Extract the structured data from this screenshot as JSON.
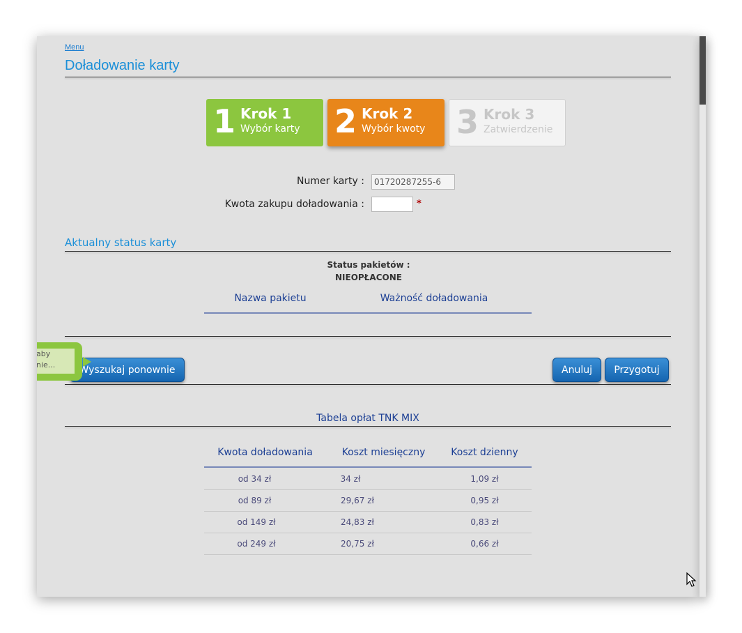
{
  "nav": {
    "menu_link": "Menu"
  },
  "page_title": "Doładowanie karty",
  "steps": [
    {
      "number": "1",
      "title": "Krok 1",
      "subtitle": "Wybór karty",
      "color": "#8cc63f"
    },
    {
      "number": "2",
      "title": "Krok 2",
      "subtitle": "Wybór kwoty",
      "color": "#e8861a"
    },
    {
      "number": "3",
      "title": "Krok 3",
      "subtitle": "Zatwierdzenie",
      "color": "#f3f3f3"
    }
  ],
  "form": {
    "card_number_label": "Numer karty :",
    "card_number_value": "01720287255-6",
    "amount_label": "Kwota zakupu doładowania :",
    "amount_value": "",
    "required_mark": "*"
  },
  "status_section": {
    "title": "Aktualny status karty",
    "packages_label": "Status pakietów :",
    "packages_value": "NIEOPŁACONE",
    "columns": [
      "Nazwa pakietu",
      "Ważność doładowania"
    ]
  },
  "tooltip": {
    "line1": "aby",
    "line2": "nie..."
  },
  "buttons": {
    "search_again": "Wyszukaj ponownie",
    "cancel": "Anuluj",
    "prepare": "Przygotuj"
  },
  "fees_table": {
    "title": "Tabela opłat TNK MIX",
    "columns": [
      "Kwota doładowania",
      "Koszt miesięczny",
      "Koszt dzienny"
    ],
    "rows": [
      [
        "od 34 zł",
        "34 zł",
        "1,09 zł"
      ],
      [
        "od 89 zł",
        "29,67 zł",
        "0,95 zł"
      ],
      [
        "od 149 zł",
        "24,83 zł",
        "0,83 zł"
      ],
      [
        "od 249 zł",
        "20,75 zł",
        "0,66 zł"
      ]
    ]
  },
  "colors": {
    "accent": "#1b8fd8",
    "step_active": "#e8861a",
    "step_done": "#8cc63f",
    "button": "#1f72c0"
  }
}
